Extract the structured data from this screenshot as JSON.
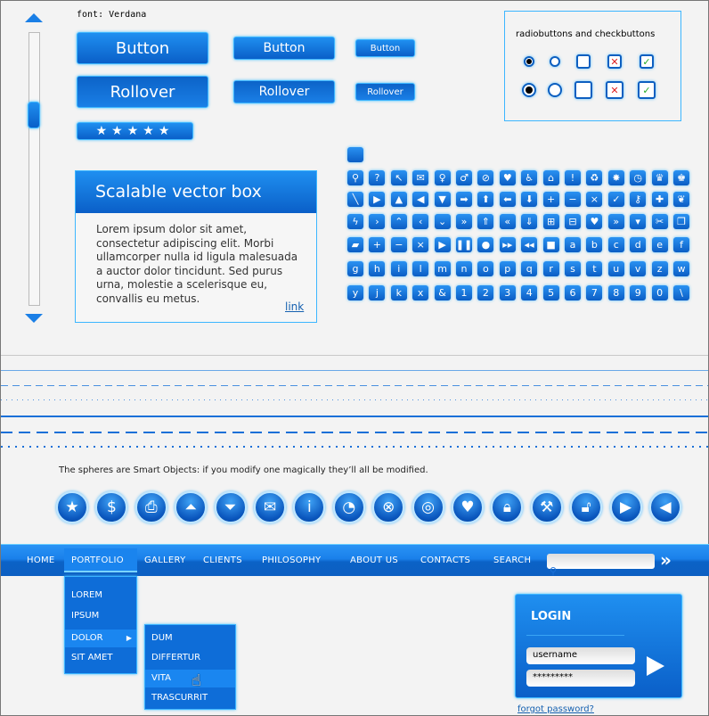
{
  "font_note": "font: Verdana",
  "buttons": {
    "button": "Button",
    "rollover": "Rollover"
  },
  "rating": {
    "stars": 5,
    "max": 5
  },
  "scroll": {
    "position": 0.28
  },
  "vector_box": {
    "title": "Scalable vector box",
    "body": "Lorem ipsum dolor sit amet, consectetur adipiscing elit. Morbi ullamcorper nulla id ligula malesuada a auctor dolor tincidunt. Sed purus urna, molestie a scelerisque eu, convallis eu metus.",
    "link": "link"
  },
  "radio_box": {
    "title": "radiobuttons and checkbuttons",
    "cross": "✕",
    "check": "✓"
  },
  "icon_grid": [
    [
      {
        "n": "search",
        "g": "⚲"
      },
      {
        "n": "question",
        "g": "?"
      },
      {
        "n": "cursor",
        "g": "↖"
      },
      {
        "n": "mail",
        "g": "✉"
      },
      {
        "n": "female",
        "g": "♀"
      },
      {
        "n": "male",
        "g": "♂"
      },
      {
        "n": "forbidden",
        "g": "⊘"
      },
      {
        "n": "heart",
        "g": "♥"
      },
      {
        "n": "wheelchair",
        "g": "♿"
      },
      {
        "n": "home",
        "g": "⌂"
      },
      {
        "n": "exclamation",
        "g": "!"
      },
      {
        "n": "recycle",
        "g": "♻"
      },
      {
        "n": "star-burst",
        "g": "✸"
      },
      {
        "n": "clock",
        "g": "◷"
      },
      {
        "n": "queen",
        "g": "♛"
      },
      {
        "n": "king",
        "g": "♚"
      }
    ],
    [
      {
        "n": "pencil",
        "g": "╲"
      },
      {
        "n": "play",
        "g": "▶"
      },
      {
        "n": "triangle-up",
        "g": "▲"
      },
      {
        "n": "triangle-left",
        "g": "◀"
      },
      {
        "n": "triangle-down",
        "g": "▼"
      },
      {
        "n": "arrow-right",
        "g": "➡"
      },
      {
        "n": "arrow-up",
        "g": "⬆"
      },
      {
        "n": "arrow-left",
        "g": "⬅"
      },
      {
        "n": "arrow-down",
        "g": "⬇"
      },
      {
        "n": "plus",
        "g": "+"
      },
      {
        "n": "minus",
        "g": "−"
      },
      {
        "n": "close",
        "g": "×"
      },
      {
        "n": "check",
        "g": "✓"
      },
      {
        "n": "key",
        "g": "⚷"
      },
      {
        "n": "puzzle",
        "g": "✚"
      },
      {
        "n": "leaf",
        "g": "❦"
      }
    ],
    [
      {
        "n": "lightning",
        "g": "ϟ"
      },
      {
        "n": "chevron-right",
        "g": "›"
      },
      {
        "n": "chevron-up",
        "g": "⌃"
      },
      {
        "n": "chevron-left",
        "g": "‹"
      },
      {
        "n": "chevron-down",
        "g": "⌄"
      },
      {
        "n": "double-chevron-right",
        "g": "»"
      },
      {
        "n": "double-chevron-up",
        "g": "⇑"
      },
      {
        "n": "double-chevron-left",
        "g": "«"
      },
      {
        "n": "double-chevron-down",
        "g": "⇓"
      },
      {
        "n": "folder-plus",
        "g": "⊞"
      },
      {
        "n": "folder-minus",
        "g": "⊟"
      },
      {
        "n": "folder-heart",
        "g": "♥"
      },
      {
        "n": "folder-forward",
        "g": "»"
      },
      {
        "n": "folder-down",
        "g": "▾"
      },
      {
        "n": "scissors",
        "g": "✂"
      },
      {
        "n": "copy",
        "g": "❐"
      }
    ],
    [
      {
        "n": "speech-bubble",
        "g": "▰"
      },
      {
        "n": "speech-bubble-plus",
        "g": "+"
      },
      {
        "n": "speech-bubble-minus",
        "g": "−"
      },
      {
        "n": "speech-bubble-x",
        "g": "×"
      },
      {
        "n": "play",
        "g": "▶"
      },
      {
        "n": "pause",
        "g": "❚❚"
      },
      {
        "n": "record",
        "g": "●"
      },
      {
        "n": "fast-forward",
        "g": "▸▸"
      },
      {
        "n": "rewind",
        "g": "◂◂"
      },
      {
        "n": "stop",
        "g": "■"
      },
      {
        "n": "letter-a",
        "g": "a"
      },
      {
        "n": "letter-b",
        "g": "b"
      },
      {
        "n": "letter-c",
        "g": "c"
      },
      {
        "n": "letter-d",
        "g": "d"
      },
      {
        "n": "letter-e",
        "g": "e"
      },
      {
        "n": "letter-f",
        "g": "f"
      }
    ],
    [
      {
        "n": "letter-g",
        "g": "g"
      },
      {
        "n": "letter-h",
        "g": "h"
      },
      {
        "n": "letter-i",
        "g": "i"
      },
      {
        "n": "letter-l",
        "g": "l"
      },
      {
        "n": "letter-m",
        "g": "m"
      },
      {
        "n": "letter-n",
        "g": "n"
      },
      {
        "n": "letter-o",
        "g": "o"
      },
      {
        "n": "letter-p",
        "g": "p"
      },
      {
        "n": "letter-q",
        "g": "q"
      },
      {
        "n": "letter-r",
        "g": "r"
      },
      {
        "n": "letter-s",
        "g": "s"
      },
      {
        "n": "letter-t",
        "g": "t"
      },
      {
        "n": "letter-u",
        "g": "u"
      },
      {
        "n": "letter-v",
        "g": "v"
      },
      {
        "n": "letter-z",
        "g": "z"
      },
      {
        "n": "letter-w",
        "g": "w"
      }
    ],
    [
      {
        "n": "letter-y",
        "g": "y"
      },
      {
        "n": "letter-j",
        "g": "j"
      },
      {
        "n": "letter-k",
        "g": "k"
      },
      {
        "n": "letter-x",
        "g": "x"
      },
      {
        "n": "ampersand",
        "g": "&"
      },
      {
        "n": "digit-1",
        "g": "1"
      },
      {
        "n": "digit-2",
        "g": "2"
      },
      {
        "n": "digit-3",
        "g": "3"
      },
      {
        "n": "digit-4",
        "g": "4"
      },
      {
        "n": "digit-5",
        "g": "5"
      },
      {
        "n": "digit-6",
        "g": "6"
      },
      {
        "n": "digit-7",
        "g": "7"
      },
      {
        "n": "digit-8",
        "g": "8"
      },
      {
        "n": "digit-9",
        "g": "9"
      },
      {
        "n": "digit-0",
        "g": "0"
      },
      {
        "n": "backslash",
        "g": "\\"
      }
    ]
  ],
  "spheres_note": "The spheres are Smart Objects: if you modify one magically they’ll all be modified.",
  "spheres": [
    {
      "n": "star",
      "g": "★"
    },
    {
      "n": "dollar",
      "g": "$"
    },
    {
      "n": "printer",
      "g": "⎙"
    },
    {
      "n": "eject-up",
      "g": "⏶"
    },
    {
      "n": "eject-down",
      "g": "⏷"
    },
    {
      "n": "mail",
      "g": "✉"
    },
    {
      "n": "info",
      "g": "i"
    },
    {
      "n": "rss",
      "g": "◔"
    },
    {
      "n": "cancel",
      "g": "⊗"
    },
    {
      "n": "target",
      "g": "◎"
    },
    {
      "n": "heart",
      "g": "♥"
    },
    {
      "n": "lock",
      "g": "🔒︎"
    },
    {
      "n": "wrench",
      "g": "⚒"
    },
    {
      "n": "unlock",
      "g": "🔓︎"
    },
    {
      "n": "play",
      "g": "▶"
    },
    {
      "n": "back",
      "g": "◀"
    }
  ],
  "nav": {
    "items": [
      "HOME",
      "PORTFOLIO",
      "GALLERY",
      "CLIENTS",
      "PHILOSOPHY",
      "ABOUT US",
      "CONTACTS",
      "SEARCH"
    ],
    "active": "PORTFOLIO",
    "search_value": "",
    "go": "»"
  },
  "dropdown": {
    "items": [
      "LOREM",
      "IPSUM",
      "DOLOR",
      "SIT AMET"
    ],
    "active": "DOLOR",
    "submenu": [
      "DUM",
      "DIFFERTUR",
      "VITA",
      "TRASCURRIT"
    ],
    "sub_active": "VITA"
  },
  "login": {
    "title": "LOGIN",
    "username": "username",
    "password": "*********",
    "forgot": "forgot password?"
  },
  "colors": {
    "accent": "#0a6ad8",
    "border": "#3cb6ff",
    "background": "#f3f3f3"
  }
}
